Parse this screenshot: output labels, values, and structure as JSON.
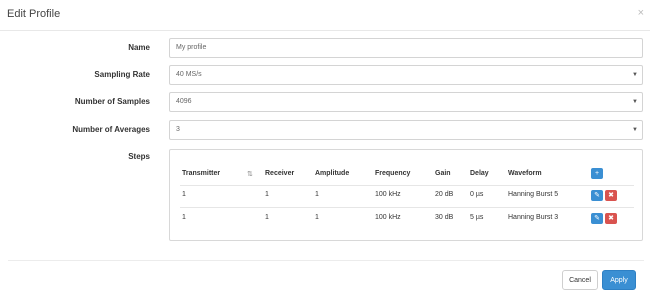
{
  "modal": {
    "title": "Edit Profile",
    "close_glyph": "×"
  },
  "form": {
    "name": {
      "label": "Name",
      "value": "My profile"
    },
    "sampling_rate": {
      "label": "Sampling Rate",
      "value": "40 MS/s"
    },
    "num_samples": {
      "label": "Number of Samples",
      "value": "4096"
    },
    "num_averages": {
      "label": "Number of Averages",
      "value": "3"
    },
    "steps": {
      "label": "Steps"
    }
  },
  "steps_table": {
    "headers": {
      "transmitter": "Transmitter",
      "receiver": "Receiver",
      "amplitude": "Amplitude",
      "frequency": "Frequency",
      "gain": "Gain",
      "delay": "Delay",
      "waveform": "Waveform"
    },
    "sort_icon": "⇅",
    "add_icon": "+",
    "edit_icon": "✎",
    "delete_icon": "✖",
    "rows": [
      {
        "transmitter": "1",
        "receiver": "1",
        "amplitude": "1",
        "frequency": "100 kHz",
        "gain": "20 dB",
        "delay": "0 µs",
        "waveform": "Hanning Burst 5"
      },
      {
        "transmitter": "1",
        "receiver": "1",
        "amplitude": "1",
        "frequency": "100 kHz",
        "gain": "30 dB",
        "delay": "5 µs",
        "waveform": "Hanning Burst 3"
      }
    ]
  },
  "footer": {
    "cancel_label": "Cancel",
    "apply_label": "Apply"
  },
  "colors": {
    "primary": "#3a8fd3",
    "danger": "#d9534f"
  }
}
